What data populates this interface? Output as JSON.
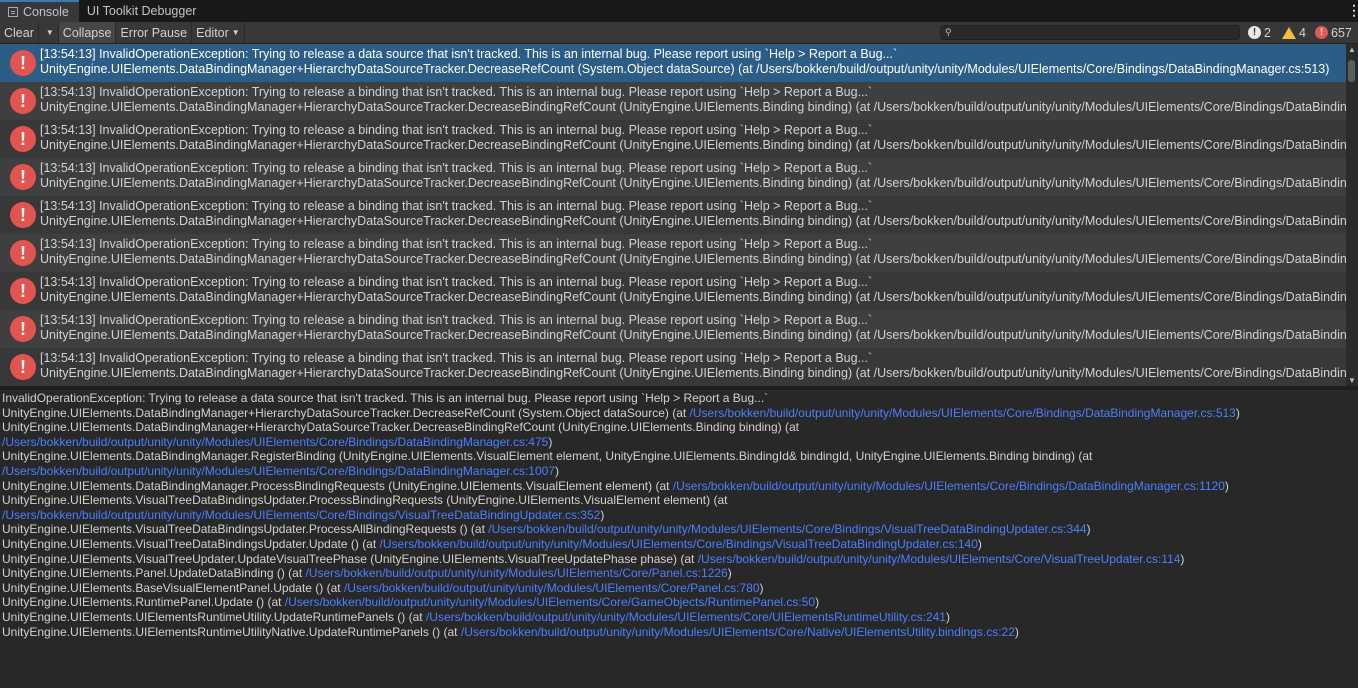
{
  "tabs": [
    {
      "label": "Console"
    },
    {
      "label": "UI Toolkit Debugger"
    }
  ],
  "toolbar": {
    "clear": "Clear",
    "collapse": "Collapse",
    "error_pause": "Error Pause",
    "editor": "Editor",
    "search_placeholder": "",
    "info_count": "2",
    "warning_count": "4",
    "error_count": "657"
  },
  "colors": {
    "error": "#e25450",
    "selection": "#2c5d87",
    "link": "#4c7fff",
    "warning": "#f2c13a"
  },
  "logs": [
    {
      "line1": "[13:54:13] InvalidOperationException: Trying to release a data source that isn't tracked. This is an internal bug. Please report using `Help > Report a Bug...`",
      "line2": "UnityEngine.UIElements.DataBindingManager+HierarchyDataSourceTracker.DecreaseRefCount (System.Object dataSource) (at /Users/bokken/build/output/unity/unity/Modules/UIElements/Core/Bindings/DataBindingManager.cs:513)"
    },
    {
      "line1": "[13:54:13] InvalidOperationException: Trying to release a binding that isn't tracked. This is an internal bug. Please report using `Help > Report a Bug...`",
      "line2": "UnityEngine.UIElements.DataBindingManager+HierarchyDataSourceTracker.DecreaseBindingRefCount (UnityEngine.UIElements.Binding binding) (at /Users/bokken/build/output/unity/unity/Modules/UIElements/Core/Bindings/DataBindingManager.cs"
    },
    {
      "line1": "[13:54:13] InvalidOperationException: Trying to release a binding that isn't tracked. This is an internal bug. Please report using `Help > Report a Bug...`",
      "line2": "UnityEngine.UIElements.DataBindingManager+HierarchyDataSourceTracker.DecreaseBindingRefCount (UnityEngine.UIElements.Binding binding) (at /Users/bokken/build/output/unity/unity/Modules/UIElements/Core/Bindings/DataBindingManager.cs"
    },
    {
      "line1": "[13:54:13] InvalidOperationException: Trying to release a binding that isn't tracked. This is an internal bug. Please report using `Help > Report a Bug...`",
      "line2": "UnityEngine.UIElements.DataBindingManager+HierarchyDataSourceTracker.DecreaseBindingRefCount (UnityEngine.UIElements.Binding binding) (at /Users/bokken/build/output/unity/unity/Modules/UIElements/Core/Bindings/DataBindingManager.cs"
    },
    {
      "line1": "[13:54:13] InvalidOperationException: Trying to release a binding that isn't tracked. This is an internal bug. Please report using `Help > Report a Bug...`",
      "line2": "UnityEngine.UIElements.DataBindingManager+HierarchyDataSourceTracker.DecreaseBindingRefCount (UnityEngine.UIElements.Binding binding) (at /Users/bokken/build/output/unity/unity/Modules/UIElements/Core/Bindings/DataBindingManager.cs"
    },
    {
      "line1": "[13:54:13] InvalidOperationException: Trying to release a binding that isn't tracked. This is an internal bug. Please report using `Help > Report a Bug...`",
      "line2": "UnityEngine.UIElements.DataBindingManager+HierarchyDataSourceTracker.DecreaseBindingRefCount (UnityEngine.UIElements.Binding binding) (at /Users/bokken/build/output/unity/unity/Modules/UIElements/Core/Bindings/DataBindingManager.cs"
    },
    {
      "line1": "[13:54:13] InvalidOperationException: Trying to release a binding that isn't tracked. This is an internal bug. Please report using `Help > Report a Bug...`",
      "line2": "UnityEngine.UIElements.DataBindingManager+HierarchyDataSourceTracker.DecreaseBindingRefCount (UnityEngine.UIElements.Binding binding) (at /Users/bokken/build/output/unity/unity/Modules/UIElements/Core/Bindings/DataBindingManager.cs"
    },
    {
      "line1": "[13:54:13] InvalidOperationException: Trying to release a binding that isn't tracked. This is an internal bug. Please report using `Help > Report a Bug...`",
      "line2": "UnityEngine.UIElements.DataBindingManager+HierarchyDataSourceTracker.DecreaseBindingRefCount (UnityEngine.UIElements.Binding binding) (at /Users/bokken/build/output/unity/unity/Modules/UIElements/Core/Bindings/DataBindingManager.cs"
    },
    {
      "line1": "[13:54:13] InvalidOperationException: Trying to release a binding that isn't tracked. This is an internal bug. Please report using `Help > Report a Bug...`",
      "line2": "UnityEngine.UIElements.DataBindingManager+HierarchyDataSourceTracker.DecreaseBindingRefCount (UnityEngine.UIElements.Binding binding) (at /Users/bokken/build/output/unity/unity/Modules/UIElements/Core/Bindings/DataBindingManager.cs"
    }
  ],
  "detail": {
    "lines": [
      {
        "text": "InvalidOperationException: Trying to release a data source that isn't tracked. This is an internal bug. Please report using `Help > Report a Bug...`",
        "link": "",
        "tail": ""
      },
      {
        "text": "UnityEngine.UIElements.DataBindingManager+HierarchyDataSourceTracker.DecreaseRefCount (System.Object dataSource) (at ",
        "link": "/Users/bokken/build/output/unity/unity/Modules/UIElements/Core/Bindings/DataBindingManager.cs:513",
        "tail": ")"
      },
      {
        "text": "UnityEngine.UIElements.DataBindingManager+HierarchyDataSourceTracker.DecreaseBindingRefCount (UnityEngine.UIElements.Binding binding) (at",
        "link": "",
        "tail": ""
      },
      {
        "text": "",
        "link": "/Users/bokken/build/output/unity/unity/Modules/UIElements/Core/Bindings/DataBindingManager.cs:475",
        "tail": ")"
      },
      {
        "text": "UnityEngine.UIElements.DataBindingManager.RegisterBinding (UnityEngine.UIElements.VisualElement element, UnityEngine.UIElements.BindingId& bindingId, UnityEngine.UIElements.Binding binding) (at",
        "link": "",
        "tail": ""
      },
      {
        "text": "",
        "link": "/Users/bokken/build/output/unity/unity/Modules/UIElements/Core/Bindings/DataBindingManager.cs:1007",
        "tail": ")"
      },
      {
        "text": "UnityEngine.UIElements.DataBindingManager.ProcessBindingRequests (UnityEngine.UIElements.VisualElement element) (at ",
        "link": "/Users/bokken/build/output/unity/unity/Modules/UIElements/Core/Bindings/DataBindingManager.cs:1120",
        "tail": ")"
      },
      {
        "text": "UnityEngine.UIElements.VisualTreeDataBindingsUpdater.ProcessBindingRequests (UnityEngine.UIElements.VisualElement element) (at",
        "link": "",
        "tail": ""
      },
      {
        "text": "",
        "link": "/Users/bokken/build/output/unity/unity/Modules/UIElements/Core/Bindings/VisualTreeDataBindingUpdater.cs:352",
        "tail": ")"
      },
      {
        "text": "UnityEngine.UIElements.VisualTreeDataBindingsUpdater.ProcessAllBindingRequests () (at ",
        "link": "/Users/bokken/build/output/unity/unity/Modules/UIElements/Core/Bindings/VisualTreeDataBindingUpdater.cs:344",
        "tail": ")"
      },
      {
        "text": "UnityEngine.UIElements.VisualTreeDataBindingsUpdater.Update () (at ",
        "link": "/Users/bokken/build/output/unity/unity/Modules/UIElements/Core/Bindings/VisualTreeDataBindingUpdater.cs:140",
        "tail": ")"
      },
      {
        "text": "UnityEngine.UIElements.VisualTreeUpdater.UpdateVisualTreePhase (UnityEngine.UIElements.VisualTreeUpdatePhase phase) (at ",
        "link": "/Users/bokken/build/output/unity/unity/Modules/UIElements/Core/VisualTreeUpdater.cs:114",
        "tail": ")"
      },
      {
        "text": "UnityEngine.UIElements.Panel.UpdateDataBinding () (at ",
        "link": "/Users/bokken/build/output/unity/unity/Modules/UIElements/Core/Panel.cs:1226",
        "tail": ")"
      },
      {
        "text": "UnityEngine.UIElements.BaseVisualElementPanel.Update () (at ",
        "link": "/Users/bokken/build/output/unity/unity/Modules/UIElements/Core/Panel.cs:780",
        "tail": ")"
      },
      {
        "text": "UnityEngine.UIElements.RuntimePanel.Update () (at ",
        "link": "/Users/bokken/build/output/unity/unity/Modules/UIElements/Core/GameObjects/RuntimePanel.cs:50",
        "tail": ")"
      },
      {
        "text": "UnityEngine.UIElements.UIElementsRuntimeUtility.UpdateRuntimePanels () (at ",
        "link": "/Users/bokken/build/output/unity/unity/Modules/UIElements/Core/UIElementsRuntimeUtility.cs:241",
        "tail": ")"
      },
      {
        "text": "UnityEngine.UIElements.UIElementsRuntimeUtilityNative.UpdateRuntimePanels () (at ",
        "link": "/Users/bokken/build/output/unity/unity/Modules/UIElements/Core/Native/UIElementsUtility.bindings.cs:22",
        "tail": ")"
      }
    ]
  }
}
